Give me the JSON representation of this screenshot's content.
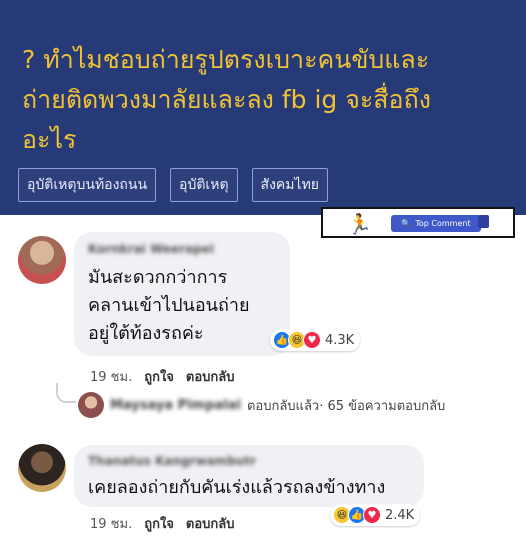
{
  "question": {
    "line1": "? ทำไมชอบถ่ายรูปตรงเบาะคนขับและ",
    "line2": "ถ่ายติดพวงมาลัยและลง fb ig จะสื่อถึง",
    "line3": "อะไร",
    "tags": [
      "อุบัติเหตุบนท้องถนน",
      "อุบัติเหตุ",
      "สังคมไทย"
    ]
  },
  "overlay": {
    "runner_icon": "running-person-icon",
    "button_label": "Top Comment"
  },
  "comment1": {
    "author": "Kornkrai Weerapei",
    "lines": [
      "มันสะดวกกว่าการ",
      "คลานเข้าไปนอนถ่าย",
      "อยู่ใต้ท้องรถค่ะ"
    ],
    "reaction_count": "4.3K",
    "time": "19 ชม.",
    "like": "ถูกใจ",
    "reply": "ตอบกลับ"
  },
  "reply1": {
    "author": "Maysaya Pimpalai",
    "action": "ตอบกลับแล้ว",
    "summary": " · 65 ข้อความตอบกลับ"
  },
  "comment2": {
    "author": "Thanatus Kangrwambutr",
    "text": "เคยลองถ่ายกับคันเร่งแล้วรถลงข้างทาง",
    "reaction_count": "2.4K",
    "time": "19 ชม.",
    "like": "ถูกใจ",
    "reply": "ตอบกลับ"
  },
  "colors": {
    "panel": "#273a78",
    "question_text": "#f2c233",
    "bubble": "#eff1f4"
  }
}
